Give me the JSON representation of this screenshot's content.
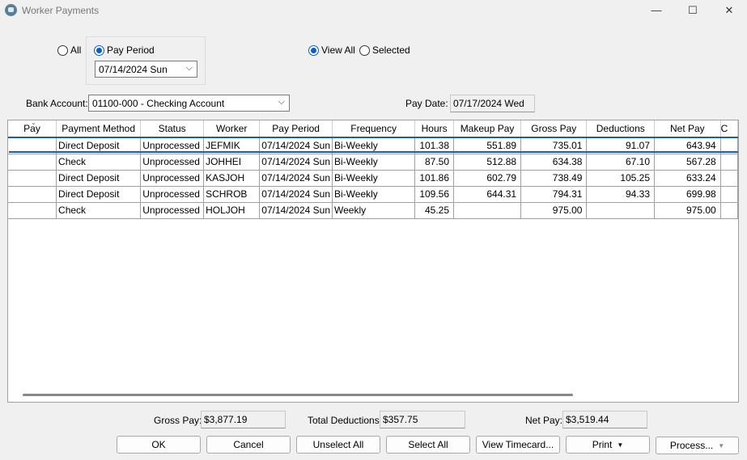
{
  "window": {
    "title": "Worker Payments",
    "icon": "app-icon"
  },
  "window_controls": {
    "minimize": "—",
    "maximize": "☐",
    "close": "✕"
  },
  "filter": {
    "all_label": "All",
    "pay_period_label": "Pay Period",
    "pay_period_value": "07/14/2024 Sun",
    "view_all_label": "View All",
    "selected_label": "Selected"
  },
  "bank": {
    "label": "Bank Account:",
    "value": "01100-000 - Checking Account"
  },
  "pay_date": {
    "label": "Pay Date:",
    "value": "07/17/2024 Wed"
  },
  "grid": {
    "columns": [
      "Pay",
      "Payment Method",
      "Status",
      "Worker",
      "Pay Period",
      "Frequency",
      "Hours",
      "Makeup Pay",
      "Gross Pay",
      "Deductions",
      "Net Pay",
      "C"
    ],
    "rows": [
      [
        "",
        "Direct Deposit",
        "Unprocessed",
        "JEFMIK",
        "07/14/2024 Sun",
        "Bi-Weekly",
        "101.38",
        "551.89",
        "735.01",
        "91.07",
        "643.94",
        ""
      ],
      [
        "",
        "Check",
        "Unprocessed",
        "JOHHEI",
        "07/14/2024 Sun",
        "Bi-Weekly",
        "87.50",
        "512.88",
        "634.38",
        "67.10",
        "567.28",
        ""
      ],
      [
        "",
        "Direct Deposit",
        "Unprocessed",
        "KASJOH",
        "07/14/2024 Sun",
        "Bi-Weekly",
        "101.86",
        "602.79",
        "738.49",
        "105.25",
        "633.24",
        ""
      ],
      [
        "",
        "Direct Deposit",
        "Unprocessed",
        "SCHROB",
        "07/14/2024 Sun",
        "Bi-Weekly",
        "109.56",
        "644.31",
        "794.31",
        "94.33",
        "699.98",
        ""
      ],
      [
        "",
        "Check",
        "Unprocessed",
        "HOLJOH",
        "07/14/2024 Sun",
        "Weekly",
        "45.25",
        "",
        "975.00",
        "",
        "975.00",
        ""
      ]
    ]
  },
  "totals": {
    "gross_label": "Gross Pay:",
    "gross_value": "$3,877.19",
    "deductions_label": "Total Deductions:",
    "deductions_value": "$357.75",
    "net_label": "Net Pay:",
    "net_value": "$3,519.44"
  },
  "buttons": {
    "ok": "OK",
    "cancel": "Cancel",
    "unselect_all": "Unselect All",
    "select_all": "Select All",
    "view_timecard": "View Timecard...",
    "print": "Print",
    "process": "Process..."
  }
}
